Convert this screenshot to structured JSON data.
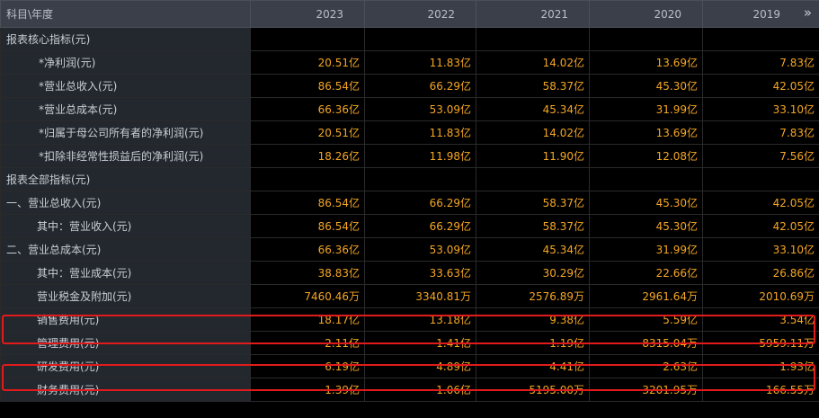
{
  "header": {
    "first": "科目\\年度",
    "years": [
      "2023",
      "2022",
      "2021",
      "2020",
      "2019"
    ]
  },
  "rows": [
    {
      "label": "报表核心指标(元)",
      "type": "section",
      "values": []
    },
    {
      "label": "*净利润(元)",
      "type": "item",
      "values": [
        "20.51亿",
        "11.83亿",
        "14.02亿",
        "13.69亿",
        "7.83亿"
      ]
    },
    {
      "label": "*营业总收入(元)",
      "type": "item",
      "values": [
        "86.54亿",
        "66.29亿",
        "58.37亿",
        "45.30亿",
        "42.05亿"
      ]
    },
    {
      "label": "*营业总成本(元)",
      "type": "item",
      "values": [
        "66.36亿",
        "53.09亿",
        "45.34亿",
        "31.99亿",
        "33.10亿"
      ]
    },
    {
      "label": "*归属于母公司所有者的净利润(元)",
      "type": "item",
      "values": [
        "20.51亿",
        "11.83亿",
        "14.02亿",
        "13.69亿",
        "7.83亿"
      ]
    },
    {
      "label": "*扣除非经常性损益后的净利润(元)",
      "type": "item",
      "values": [
        "18.26亿",
        "11.98亿",
        "11.90亿",
        "12.08亿",
        "7.56亿"
      ]
    },
    {
      "label": "报表全部指标(元)",
      "type": "section",
      "values": []
    },
    {
      "label": "一、营业总收入(元)",
      "type": "section",
      "values": [
        "86.54亿",
        "66.29亿",
        "58.37亿",
        "45.30亿",
        "42.05亿"
      ]
    },
    {
      "label": "其中：营业收入(元)",
      "type": "sub",
      "values": [
        "86.54亿",
        "66.29亿",
        "58.37亿",
        "45.30亿",
        "42.05亿"
      ]
    },
    {
      "label": "二、营业总成本(元)",
      "type": "section",
      "values": [
        "66.36亿",
        "53.09亿",
        "45.34亿",
        "31.99亿",
        "33.10亿"
      ]
    },
    {
      "label": "其中：营业成本(元)",
      "type": "sub",
      "values": [
        "38.83亿",
        "33.63亿",
        "30.29亿",
        "22.66亿",
        "26.86亿"
      ]
    },
    {
      "label": "营业税金及附加(元)",
      "type": "sub",
      "values": [
        "7460.46万",
        "3340.81万",
        "2576.89万",
        "2961.64万",
        "2010.69万"
      ]
    },
    {
      "label": "销售费用(元)",
      "type": "sub",
      "values": [
        "18.17亿",
        "13.18亿",
        "9.38亿",
        "5.59亿",
        "3.54亿"
      ]
    },
    {
      "label": "管理费用(元)",
      "type": "sub",
      "values": [
        "2.11亿",
        "1.41亿",
        "1.19亿",
        "8315.04万",
        "5959.11万"
      ]
    },
    {
      "label": "研发费用(元)",
      "type": "sub",
      "values": [
        "6.19亿",
        "4.89亿",
        "4.41亿",
        "2.63亿",
        "1.93亿"
      ]
    },
    {
      "label": "财务费用(元)",
      "type": "sub",
      "values": [
        "-1.39亿",
        "-1.06亿",
        "-5195.00万",
        "-3201.95万",
        "-166.55万"
      ]
    }
  ],
  "highlighted_rows": [
    "销售费用(元)",
    "研发费用(元)"
  ],
  "colors": {
    "value": "#f5a623",
    "label_bg": "#23272e",
    "header_bg": "#3a3f49",
    "highlight": "#e11b1b"
  },
  "icons": {
    "expand": "double-chevron-right-icon"
  }
}
